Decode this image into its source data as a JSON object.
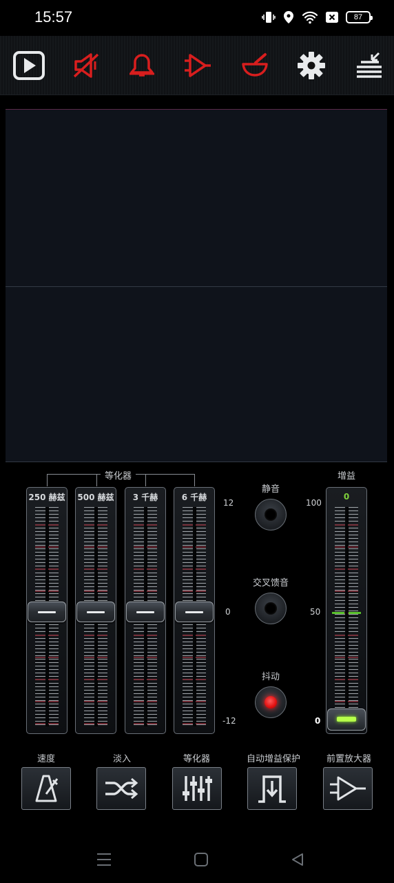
{
  "status_bar": {
    "time": "15:57",
    "battery": "87",
    "icons": [
      "vibrate-icon",
      "location-icon",
      "wifi-icon",
      "sim-off-icon",
      "battery-icon"
    ]
  },
  "toolbar": {
    "buttons": [
      {
        "name": "play-button",
        "icon": "play-icon",
        "color": "#e8eaec"
      },
      {
        "name": "speaker-muted-button",
        "icon": "speaker-off-icon",
        "color": "#d81e1e"
      },
      {
        "name": "bell-off-button",
        "icon": "bell-off-icon",
        "color": "#d81e1e"
      },
      {
        "name": "amplifier-off-button",
        "icon": "amplifier-off-icon",
        "color": "#d81e1e"
      },
      {
        "name": "mortar-off-button",
        "icon": "mortar-off-icon",
        "color": "#d81e1e"
      },
      {
        "name": "settings-button",
        "icon": "gear-icon",
        "color": "#e8eaec"
      },
      {
        "name": "menu-collapse-button",
        "icon": "menu-arrow-icon",
        "color": "#e8eaec"
      }
    ]
  },
  "equalizer": {
    "group_label": "等化器",
    "bands": [
      {
        "label": "250 赫兹",
        "value": 0
      },
      {
        "label": "500 赫兹",
        "value": 0
      },
      {
        "label": "3 千赫",
        "value": 0
      },
      {
        "label": "6 千赫",
        "value": 0
      }
    ],
    "scale": {
      "top": "12",
      "middle": "0",
      "bottom": "-12"
    }
  },
  "toggles": {
    "mute": {
      "label": "静音",
      "active": false
    },
    "crossfeed": {
      "label": "交叉馈音",
      "active": false
    },
    "dither": {
      "label": "抖动",
      "active": true
    }
  },
  "gain": {
    "label": "增益",
    "value": "0",
    "level": 0,
    "scale": {
      "top": "100",
      "middle": "50",
      "bottom": "0"
    }
  },
  "bottom_buttons": [
    {
      "label": "速度",
      "icon": "metronome-icon"
    },
    {
      "label": "淡入",
      "icon": "shuffle-crossfade-icon"
    },
    {
      "label": "等化器",
      "icon": "equalizer-sliders-icon"
    },
    {
      "label": "自动增益保护",
      "icon": "auto-gain-protect-icon"
    },
    {
      "label": "前置放大器",
      "icon": "preamp-icon"
    }
  ],
  "accent_colors": {
    "red": "#d81e1e",
    "green": "#7fd13b"
  }
}
